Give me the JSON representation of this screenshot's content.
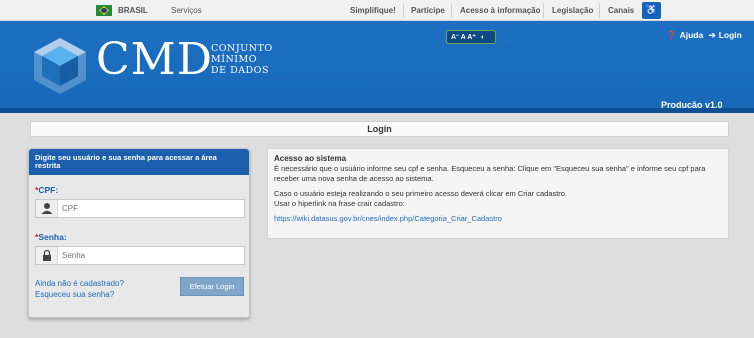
{
  "govbar": {
    "brasil": "BRASIL",
    "servicos": "Serviços",
    "links": [
      "Simplifique!",
      "Participe",
      "Acesso à informação",
      "Legislação",
      "Canais"
    ]
  },
  "header": {
    "brand": "CMD",
    "brand_sub": [
      "CONJUNTO",
      "MÍNIMO",
      "DE DADOS"
    ],
    "font_controls": "Aᐨ A A⁺",
    "ajuda": "Ajuda",
    "login": "Login",
    "env": "Produção  v1.0"
  },
  "login_bar": {
    "title": "Login"
  },
  "panel": {
    "heading": "Digite seu usuário e sua senha para acessar a área restrita",
    "cpf_label": "CPF:",
    "cpf_placeholder": "CPF",
    "senha_label": "Senha:",
    "senha_placeholder": "Senha",
    "link_cadastro": "Ainda não é cadastrado?",
    "link_senha": "Esqueceu sua senha?",
    "submit": "Efetuar Login"
  },
  "info": {
    "title": "Acesso ao sistema",
    "p1": "É necessário que o usuário informe seu cpf e senha. Esqueceu a senha: Clique em \"Esqueceu sua senha\" e informe seu cpf para receber uma nova senha de acesso ao sistema.",
    "p2": "Caso o usuário esteja realizando o seu primeiro acesso deverá clicar em Criar cadastro.",
    "p3": "Usar o hiperlink na frase crair cadastro:",
    "link": "https://wiki.datasus.gov.br/cnes/index.php/Categoria_Criar_Cadastro"
  },
  "colors": {
    "header_blue": "#1c6fc2",
    "panel_head": "#1b5fad",
    "link": "#1f6cbc",
    "required": "#dd1111"
  }
}
